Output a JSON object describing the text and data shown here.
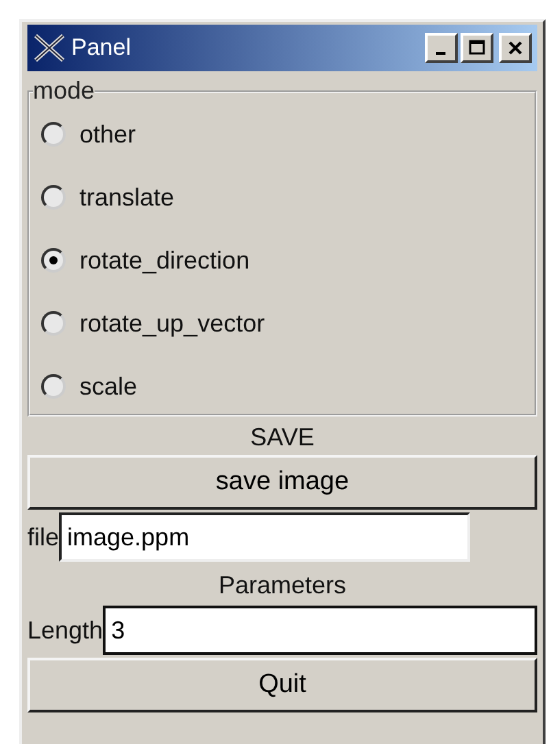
{
  "window": {
    "title": "Panel"
  },
  "mode": {
    "label": "mode",
    "options": [
      {
        "label": "other",
        "selected": false
      },
      {
        "label": "translate",
        "selected": false
      },
      {
        "label": "rotate_direction",
        "selected": true
      },
      {
        "label": "rotate_up_vector",
        "selected": false
      },
      {
        "label": "scale",
        "selected": false
      }
    ]
  },
  "save": {
    "heading": "SAVE",
    "button": "save image",
    "file_label": "file",
    "file_value": "image.ppm"
  },
  "parameters": {
    "heading": "Parameters",
    "length_label": "Length",
    "length_value": "3"
  },
  "quit": "Quit"
}
